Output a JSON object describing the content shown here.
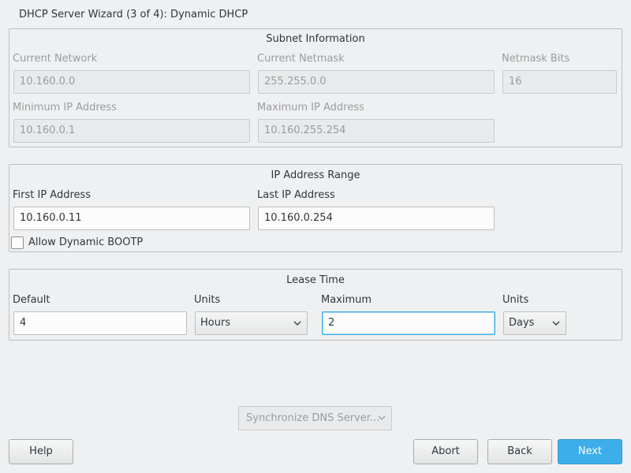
{
  "window": {
    "title": "DHCP Server Wizard (3 of 4): Dynamic DHCP"
  },
  "subnet": {
    "title": "Subnet Information",
    "current_network_label": "Current Network",
    "current_network_value": "10.160.0.0",
    "current_netmask_label": "Current Netmask",
    "current_netmask_value": "255.255.0.0",
    "netmask_bits_label": "Netmask Bits",
    "netmask_bits_value": "16",
    "min_ip_label": "Minimum IP Address",
    "min_ip_value": "10.160.0.1",
    "max_ip_label": "Maximum IP Address",
    "max_ip_value": "10.160.255.254"
  },
  "range": {
    "title": "IP Address Range",
    "first_ip_label": "First IP Address",
    "first_ip_value": "10.160.0.11",
    "last_ip_label": "Last IP Address",
    "last_ip_value": "10.160.0.254",
    "bootp_label": "Allow Dynamic BOOTP",
    "bootp_checked": false
  },
  "lease": {
    "title": "Lease Time",
    "default_label": "Default",
    "default_value": "4",
    "units_label": "Units",
    "default_units_value": "Hours",
    "maximum_label": "Maximum",
    "maximum_value": "2",
    "max_units_label": "Units",
    "max_units_value": "Days"
  },
  "sync_dns": {
    "label": "Synchronize DNS Server..."
  },
  "buttons": {
    "help": "Help",
    "abort": "Abort",
    "back": "Back",
    "next": "Next"
  },
  "icons": {
    "combo_arrow": "chevron-down-icon"
  },
  "colors": {
    "accent": "#3daee9",
    "background": "#eff0f1"
  }
}
